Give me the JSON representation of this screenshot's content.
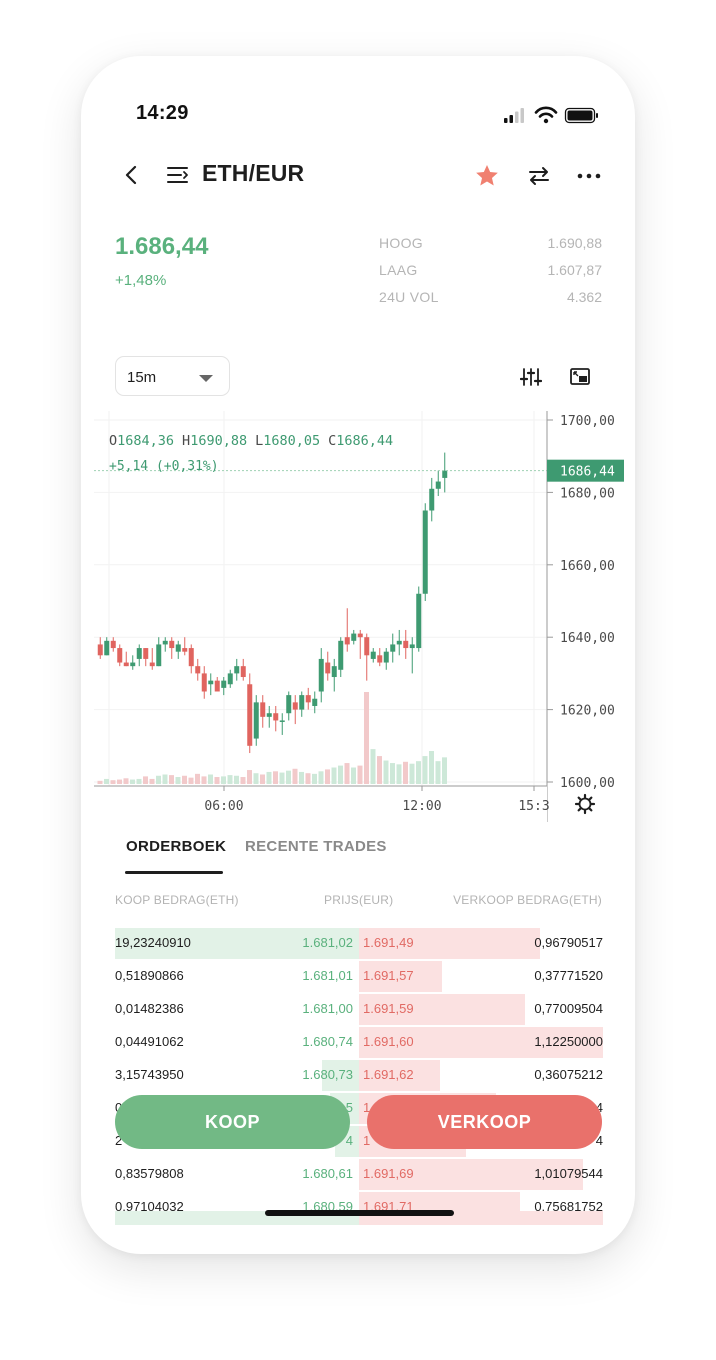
{
  "status_bar": {
    "time": "14:29"
  },
  "header": {
    "pair": "ETH/EUR",
    "icons": [
      "back-chevron-icon",
      "list-icon",
      "star-icon",
      "swap-icon",
      "more-icon"
    ],
    "star_color": "#f08070"
  },
  "ticker": {
    "price": "1.686,44",
    "change": "+1,48%",
    "stats": [
      {
        "label": "HOOG",
        "value": "1.690,88"
      },
      {
        "label": "LAAG",
        "value": "1.607,87"
      },
      {
        "label": "24U VOL",
        "value": "4.362"
      }
    ]
  },
  "chart_controls": {
    "interval": "15m",
    "icons": [
      "settings-sliders-icon",
      "fullscreen-icon"
    ]
  },
  "chart_data": {
    "type": "candlestick",
    "ohlc_label": {
      "o_key": "O",
      "o": "1684,36",
      "h_key": "H",
      "h": "1690,88",
      "l_key": "L",
      "l": "1680,05",
      "c_key": "C",
      "c": "1686,44"
    },
    "change_label": "+5,14 (+0,31%)",
    "current_price_label": "1686,44",
    "y_ticks": [
      "1700,00",
      "1680,00",
      "1660,00",
      "1640,00",
      "1620,00",
      "1600,00"
    ],
    "ylim": [
      1600,
      1700
    ],
    "x_ticks": [
      "06:00",
      "12:00",
      "15:3"
    ],
    "candles": [
      [
        1638,
        1640,
        1634,
        1635
      ],
      [
        1635,
        1640,
        1635,
        1639
      ],
      [
        1639,
        1640,
        1636,
        1637
      ],
      [
        1637,
        1638,
        1632,
        1633
      ],
      [
        1633,
        1636,
        1632,
        1632
      ],
      [
        1632,
        1635,
        1631,
        1633
      ],
      [
        1634,
        1638,
        1632,
        1637
      ],
      [
        1637,
        1637,
        1632,
        1634
      ],
      [
        1633,
        1637,
        1631,
        1632
      ],
      [
        1632,
        1640,
        1632,
        1638
      ],
      [
        1638,
        1640,
        1636,
        1639
      ],
      [
        1639,
        1640,
        1634,
        1637
      ],
      [
        1636,
        1639,
        1634,
        1638
      ],
      [
        1637,
        1640,
        1635,
        1636
      ],
      [
        1637,
        1638,
        1630,
        1632
      ],
      [
        1632,
        1634,
        1628,
        1630
      ],
      [
        1630,
        1632,
        1623,
        1625
      ],
      [
        1627,
        1630,
        1624,
        1628
      ],
      [
        1628,
        1629,
        1625,
        1625
      ],
      [
        1626,
        1629,
        1624,
        1628
      ],
      [
        1627,
        1631,
        1626,
        1630
      ],
      [
        1630,
        1634,
        1628,
        1632
      ],
      [
        1632,
        1634,
        1628,
        1629
      ],
      [
        1627,
        1630,
        1608,
        1610
      ],
      [
        1612,
        1624,
        1610,
        1622
      ],
      [
        1622,
        1624,
        1615,
        1618
      ],
      [
        1618,
        1621,
        1615,
        1619
      ],
      [
        1619,
        1621,
        1614,
        1617
      ],
      [
        1617,
        1619,
        1613,
        1617
      ],
      [
        1619,
        1625,
        1617,
        1624
      ],
      [
        1622,
        1624,
        1616,
        1620
      ],
      [
        1620,
        1625,
        1618,
        1624
      ],
      [
        1624,
        1626,
        1620,
        1622
      ],
      [
        1621,
        1625,
        1619,
        1623
      ],
      [
        1625,
        1637,
        1622,
        1634
      ],
      [
        1633,
        1636,
        1628,
        1630
      ],
      [
        1629,
        1634,
        1625,
        1632
      ],
      [
        1631,
        1640,
        1629,
        1639
      ],
      [
        1640,
        1648,
        1636,
        1638
      ],
      [
        1639,
        1642,
        1638,
        1641
      ],
      [
        1641,
        1642,
        1634,
        1640
      ],
      [
        1640,
        1641,
        1628,
        1635
      ],
      [
        1634,
        1637,
        1633,
        1636
      ],
      [
        1635,
        1637,
        1632,
        1633
      ],
      [
        1633,
        1637,
        1631,
        1636
      ],
      [
        1636,
        1641,
        1633,
        1638
      ],
      [
        1638,
        1642,
        1635,
        1639
      ],
      [
        1639,
        1642,
        1634,
        1637
      ],
      [
        1637,
        1640,
        1630,
        1638
      ],
      [
        1637,
        1654,
        1636,
        1652
      ],
      [
        1652,
        1677,
        1650,
        1675
      ],
      [
        1675,
        1684,
        1672,
        1681
      ],
      [
        1681,
        1686,
        1679,
        1683
      ],
      [
        1684,
        1691,
        1680,
        1686
      ]
    ],
    "volumes": [
      0.5,
      0.8,
      0.6,
      0.7,
      0.9,
      0.7,
      0.8,
      1.2,
      0.8,
      1.3,
      1.5,
      1.4,
      1.1,
      1.3,
      1.0,
      1.6,
      1.2,
      1.5,
      1.1,
      1.2,
      1.4,
      1.3,
      1.1,
      2.2,
      1.7,
      1.5,
      1.9,
      2.0,
      1.8,
      2.1,
      2.4,
      1.9,
      1.7,
      1.6,
      2.0,
      2.3,
      2.6,
      2.9,
      3.3,
      2.6,
      2.9,
      14.5,
      5.5,
      4.4,
      3.7,
      3.3,
      3.1,
      3.5,
      3.2,
      3.6,
      4.4,
      5.2,
      3.6,
      4.2
    ]
  },
  "orderbook": {
    "tabs": [
      "ORDERBOEK",
      "RECENTE TRADES"
    ],
    "headers": {
      "buy": "KOOP BEDRAG(ETH)",
      "price": "PRIJS(EUR)",
      "sell": "VERKOOP BEDRAG(ETH)"
    },
    "rows": [
      {
        "buy_amount": "19,23240910",
        "buy_price": "1.681,02",
        "sell_price": "1.691,49",
        "sell_amount": "0,96790517",
        "buy_depth": 1.0,
        "sell_depth": 0.74
      },
      {
        "buy_amount": "0,51890866",
        "buy_price": "1.681,01",
        "sell_price": "1.691,57",
        "sell_amount": "0,37771520",
        "buy_depth": 0.0,
        "sell_depth": 0.34
      },
      {
        "buy_amount": "0,01482386",
        "buy_price": "1.681,00",
        "sell_price": "1.691,59",
        "sell_amount": "0,77009504",
        "buy_depth": 0.0,
        "sell_depth": 0.68
      },
      {
        "buy_amount": "0,04491062",
        "buy_price": "1.680,74",
        "sell_price": "1.691,60",
        "sell_amount": "1,12250000",
        "buy_depth": 0.0,
        "sell_depth": 1.0
      },
      {
        "buy_amount": "3,15743950",
        "buy_price": "1.680,73",
        "sell_price": "1.691,62",
        "sell_amount": "0,36075212",
        "buy_depth": 0.15,
        "sell_depth": 0.33
      },
      {
        "buy_amount": "0",
        "buy_price": "5",
        "sell_price": "1",
        "sell_amount": "4",
        "buy_depth": 0.12,
        "sell_depth": 0.56
      },
      {
        "buy_amount": "2",
        "buy_price": "4",
        "sell_price": "1",
        "sell_amount": "4",
        "buy_depth": 0.1,
        "sell_depth": 0.44
      },
      {
        "buy_amount": "0,83579808",
        "buy_price": "1.680,61",
        "sell_price": "1.691,69",
        "sell_amount": "1,01079544",
        "buy_depth": 0.0,
        "sell_depth": 0.92
      },
      {
        "buy_amount": "0,97104032",
        "buy_price": "1.680,59",
        "sell_price": "1.691,71",
        "sell_amount": "0,75681752",
        "buy_depth": 0.0,
        "sell_depth": 0.66
      }
    ]
  },
  "actions": {
    "buy_label": "KOOP",
    "sell_label": "VERKOOP"
  },
  "colors": {
    "up": "#3e9a71",
    "down": "#e0645f",
    "buy_text": "#5ab17d",
    "sell_text": "#e16a64",
    "buy_button": "#72b985",
    "sell_button": "#e9716b"
  }
}
